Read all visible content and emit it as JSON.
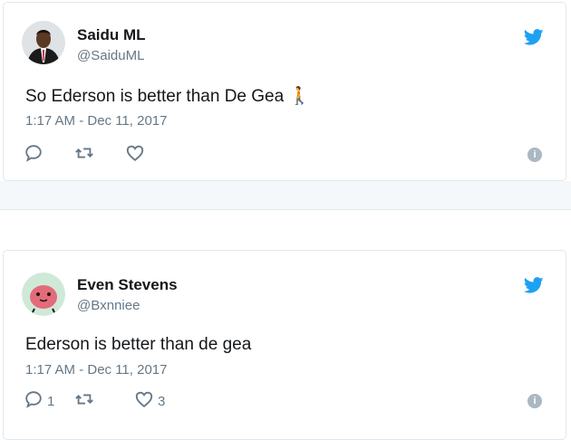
{
  "colors": {
    "twitter_blue": "#1da1f2",
    "secondary_text": "#657786",
    "border": "#e1e8ed",
    "background_band": "#f5f8fa"
  },
  "tweets": [
    {
      "name": "Saidu ML",
      "handle": "@SaiduML",
      "text": "So Ederson is better than De Gea ",
      "emoji": "🚶",
      "timestamp": "1:17 AM - Dec 11, 2017",
      "reply_count": "",
      "retweet_count": "",
      "like_count": "",
      "icons": [
        "avatar",
        "twitter-bird-icon",
        "reply-icon",
        "retweet-icon",
        "like-icon",
        "info-icon"
      ]
    },
    {
      "name": "Even Stevens",
      "handle": "@Bxnniee",
      "text": "Ederson is better than de gea",
      "timestamp": "1:17 AM - Dec 11, 2017",
      "reply_count": "1",
      "retweet_count": "",
      "like_count": "3",
      "icons": [
        "avatar",
        "twitter-bird-icon",
        "reply-icon",
        "retweet-icon",
        "like-icon",
        "info-icon"
      ]
    }
  ]
}
